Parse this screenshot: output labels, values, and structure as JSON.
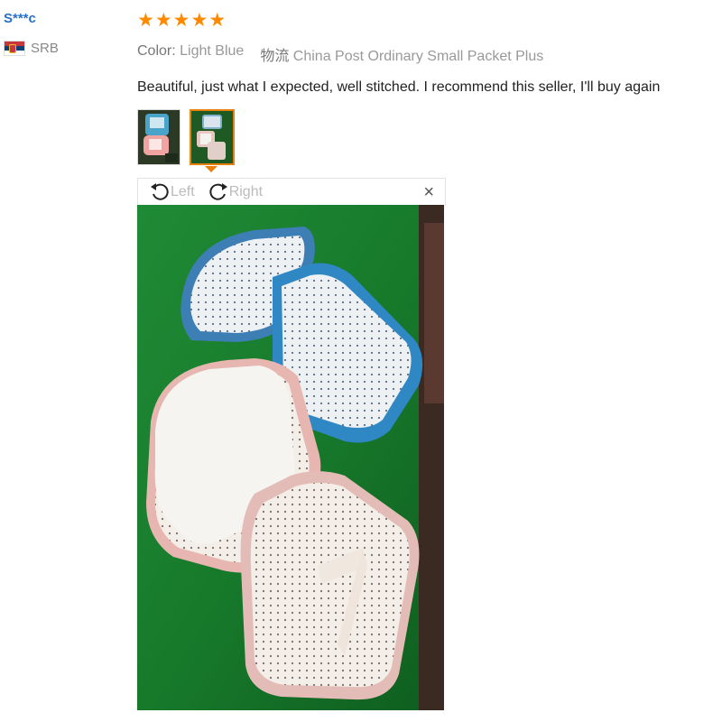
{
  "reviewer": {
    "name": "S***c",
    "country_code": "SRB",
    "flag_icon": "serbia-flag-icon"
  },
  "rating": {
    "stars": 5,
    "max": 5,
    "star_color": "#ff8a00"
  },
  "attributes": {
    "color_label": "Color:",
    "color_value": "Light Blue",
    "shipping_label": "物流",
    "shipping_value": "China Post Ordinary Small Packet Plus"
  },
  "review_text": "Beautiful, just what I expected, well stitched. I recommend this seller, I'll buy again",
  "thumbnails": [
    {
      "name": "photo-thumbnail-1",
      "active": false
    },
    {
      "name": "photo-thumbnail-2",
      "active": true
    }
  ],
  "viewer": {
    "rotate_left_label": "Left",
    "rotate_right_label": "Right",
    "close_symbol": "×"
  },
  "colors": {
    "accent": "#e8800e",
    "username": "#2a6fc7"
  }
}
